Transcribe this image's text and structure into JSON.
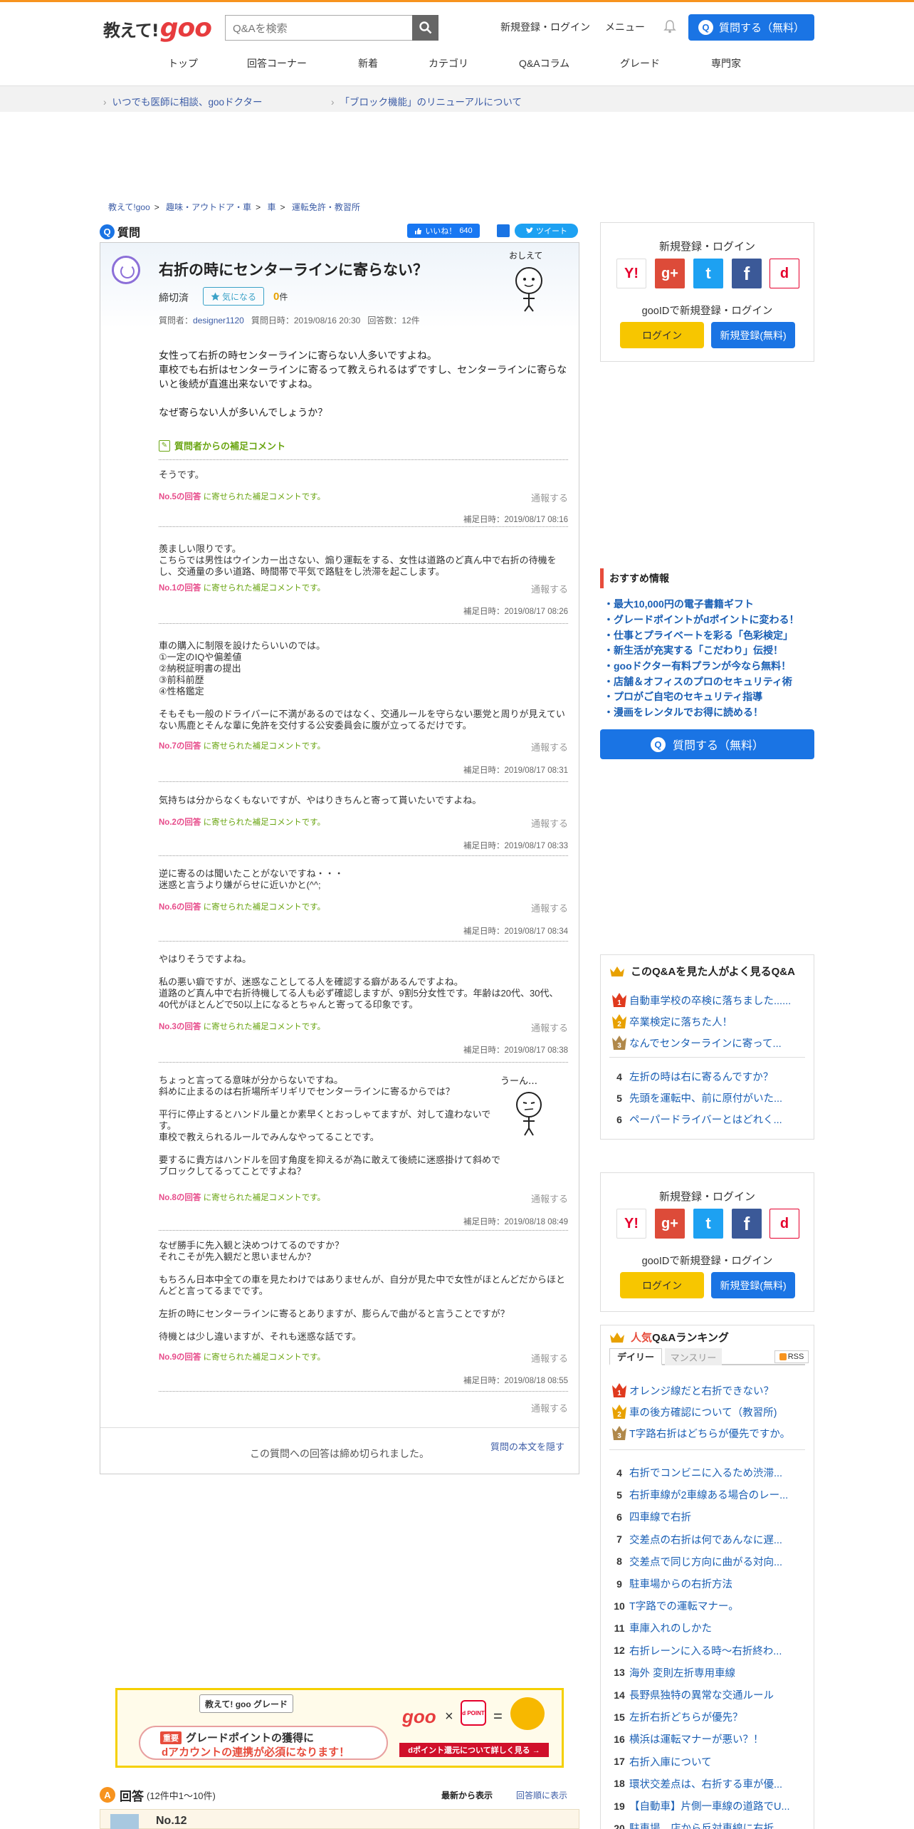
{
  "header": {
    "logo_jp": "教えて!",
    "logo_goo": "goo",
    "search_placeholder": "Q&Aを検索",
    "register_login": "新規登録・ログイン",
    "menu": "メニュー",
    "ask_button": "質問する（無料）",
    "nav": [
      "トップ",
      "回答コーナー",
      "新着",
      "カテゴリ",
      "Q&Aコラム",
      "グレード",
      "専門家"
    ]
  },
  "subbar": [
    "いつでも医師に相談、gooドクター",
    "「ブロック機能」のリニューアルについて"
  ],
  "breadcrumb": [
    "教えて!goo",
    "趣味・アウトドア・車",
    "車",
    "運転免許・教習所"
  ],
  "question": {
    "label": "質問",
    "like_label": "いいね！",
    "like_count": "640",
    "tweet": "ツイート",
    "title": "右折の時にセンターラインに寄らない？",
    "status": "締切済",
    "favorite": "気になる",
    "fav_count": "0",
    "fav_unit": "件",
    "meta_asker_label": "質問者：",
    "meta_asker": "designer1120",
    "meta_date": "質問日時：2019/08/16 20:30",
    "meta_answers": "回答数：12件",
    "body": "女性って右折の時センターラインに寄らない人多いですよね。\n車校でも右折はセンターラインに寄るって教えられるはずですし、センターラインに寄らないと後続が直進出来ないですよね。\n\nなぜ寄らない人が多いんでしょうか？",
    "supplement_header": "質問者からの補足コメント",
    "from_suffix": "に寄せられた補足コメントです。",
    "report": "通報する",
    "supplements": [
      {
        "text": "そうです。",
        "no": "No.5の回答",
        "stamp": "補足日時：2019/08/17 08:16"
      },
      {
        "text": "羨ましい限りです。\nこちらでは男性はウインカー出さない、煽り運転をする、女性は道路のど真ん中で右折の待機をし、交通量の多い道路、時間帯で平気で路駐をし渋滞を起こします。",
        "no": "No.1の回答",
        "stamp": "補足日時：2019/08/17 08:26"
      },
      {
        "text": "車の購入に制限を設けたらいいのでは。\n①一定のIQや偏差値\n②納税証明書の提出\n③前科前歴\n④性格鑑定\n\nそもそも一般のドライバーに不満があるのではなく、交通ルールを守らない悪党と周りが見えていない馬鹿とそんな輩に免許を交付する公安委員会に腹が立ってるだけです。",
        "no": "No.7の回答",
        "stamp": "補足日時：2019/08/17 08:31"
      },
      {
        "text": "気持ちは分からなくもないですが、やはりきちんと寄って貰いたいですよね。",
        "no": "No.2の回答",
        "stamp": "補足日時：2019/08/17 08:33"
      },
      {
        "text": "逆に寄るのは聞いたことがないですね・・・\n迷惑と言うより嫌がらせに近いかと(^^;",
        "no": "No.6の回答",
        "stamp": "補足日時：2019/08/17 08:34"
      },
      {
        "text": "やはりそうですよね。\n\n私の悪い癖ですが、迷惑なことしてる人を確認する癖があるんですよね。\n道路のど真ん中で右折待機してる人も必ず確認しますが、9割5分女性です。年齢は20代、30代、40代がほとんどで50以上になるとちゃんと寄ってる印象です。",
        "no": "No.3の回答",
        "stamp": "補足日時：2019/08/17 08:38"
      },
      {
        "text": "ちょっと言ってる意味が分からないですね。\n斜めに止まるのは右折場所ギリギリでセンターラインに寄るからでは？\n\n平行に停止するとハンドル量とか素早くとおっしゃてますが、対して違わないです。\n車校で教えられるルールでみんなやってることです。\n\n要するに貴方はハンドルを回す角度を抑えるが為に敢えて後続に迷惑掛けて斜めでブロックしてるってことですよね？",
        "no": "No.8の回答",
        "stamp": "補足日時：2019/08/18 08:49"
      },
      {
        "text": "なぜ勝手に先入観と決めつけてるのですか？\nそれこそが先入観だと思いませんか？\n\nもちろん日本中全ての車を見たわけではありませんが、自分が見た中で女性がほとんどだからほとんどと言ってるまでです。\n\n左折の時にセンターラインに寄るとありますが、膨らんで曲がると言うことですが？\n\n待機とは少し違いますが、それも迷惑な話です。",
        "no": "No.9の回答",
        "stamp": "補足日時：2019/08/18 08:55"
      }
    ],
    "closed_message": "この質問への回答は締め切られました。",
    "hide_question": "質問の本文を隠す"
  },
  "sidebar": {
    "login": {
      "title": "新規登録・ログイン",
      "sns": [
        "Y!",
        "g+",
        "t",
        "f",
        "d"
      ],
      "gooid": "gooIDで新規登録・ログイン",
      "login_btn": "ログイン",
      "register_btn": "新規登録(無料)"
    },
    "recommend_title": "おすすめ情報",
    "recommend": [
      "・最大10,000円の電子書籍ギフト",
      "・グレードポイントがdポイントに変わる！",
      "・仕事とプライベートを彩る「色彩検定」",
      "・新生活が充実する「こだわり」伝授！",
      "・gooドクター有料プランが今なら無料！",
      "・店舗＆オフィスのプロのセキュリティ術",
      "・プロがご自宅のセキュリティ指導",
      "・漫画をレンタルでお得に読める！"
    ],
    "ask_button": "質問する（無料）",
    "related_title": "このQ&Aを見た人がよく見るQ&A",
    "related": [
      {
        "n": "1",
        "t": "自動車学校の卒検に落ちました......"
      },
      {
        "n": "2",
        "t": "卒業検定に落ちた人！"
      },
      {
        "n": "3",
        "t": "なんでセンターラインに寄って..."
      },
      {
        "n": "4",
        "t": "左折の時は右に寄るんですか？"
      },
      {
        "n": "5",
        "t": "先頭を運転中、前に原付がいた..."
      },
      {
        "n": "6",
        "t": "ペーパードライバーとはどれく..."
      }
    ],
    "ranking_title_pre": "人気",
    "ranking_title": "Q&Aランキング",
    "tab_daily": "デイリー",
    "tab_monthly": "マンスリー",
    "rss": "RSS",
    "ranking": [
      {
        "n": "1",
        "t": "オレンジ線だと右折できない？"
      },
      {
        "n": "2",
        "t": "車の後方確認について（教習所)"
      },
      {
        "n": "3",
        "t": "T字路右折はどちらが優先ですか。"
      },
      {
        "n": "4",
        "t": "右折でコンビニに入るため渋滞..."
      },
      {
        "n": "5",
        "t": "右折車線が2車線ある場合のレー..."
      },
      {
        "n": "6",
        "t": "四車線で右折"
      },
      {
        "n": "7",
        "t": "交差点の右折は何であんなに遅..."
      },
      {
        "n": "8",
        "t": "交差点で同じ方向に曲がる対向..."
      },
      {
        "n": "9",
        "t": "駐車場からの右折方法"
      },
      {
        "n": "10",
        "t": "T字路での運転マナー。"
      },
      {
        "n": "11",
        "t": "車庫入れのしかた"
      },
      {
        "n": "12",
        "t": "右折レーンに入る時～右折終わ..."
      },
      {
        "n": "13",
        "t": "海外 変則左折専用車線"
      },
      {
        "n": "14",
        "t": "長野県独特の異常な交通ルール"
      },
      {
        "n": "15",
        "t": "左折右折どちらが優先？"
      },
      {
        "n": "16",
        "t": "横浜は運転マナーが悪い？！"
      },
      {
        "n": "17",
        "t": "右折入庫について"
      },
      {
        "n": "18",
        "t": "環状交差点は、右折する車が優..."
      },
      {
        "n": "19",
        "t": "【自動車】片側一車線の道路でU..."
      },
      {
        "n": "20",
        "t": "駐車場、店から反対車線に右折..."
      }
    ]
  },
  "banner": {
    "grade_logo": "教えて! goo グレード",
    "line1": "グレードポイントの獲得に",
    "line2": "dアカウントの連携が必須になります！",
    "badge": "重要",
    "goo": "goo",
    "times": "×",
    "dpoint": "d POINT",
    "equals": "=",
    "link": "dポイント還元について詳しく見る →"
  },
  "answers": {
    "label": "回答",
    "count": "(12件中1～10件)",
    "sort_new": "最新から表示",
    "sort_order": "回答順に表示",
    "first_no": "No.12"
  }
}
